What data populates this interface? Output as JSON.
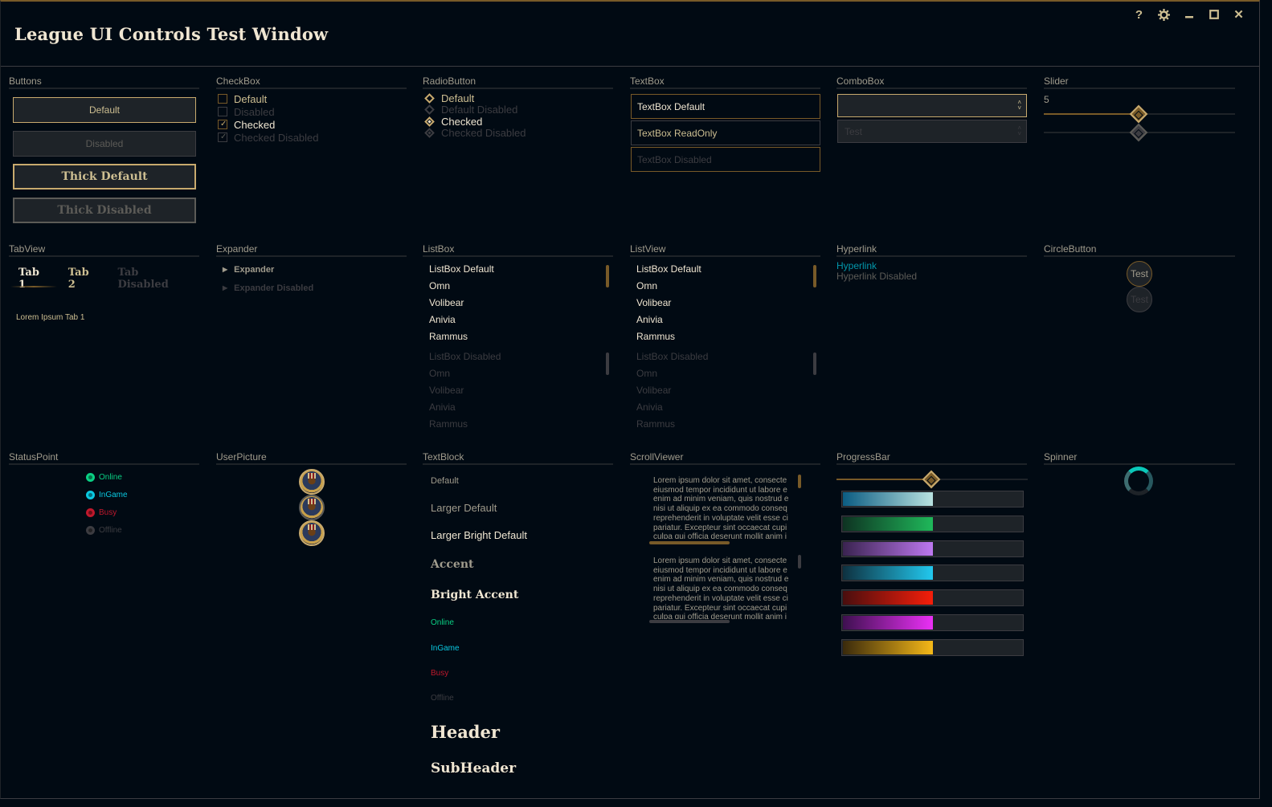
{
  "window": {
    "title": "League UI Controls Test Window",
    "buttons": [
      {
        "name": "help-button",
        "icon": "question-icon",
        "glyph": "?"
      },
      {
        "name": "settings-button",
        "icon": "gear-icon"
      },
      {
        "name": "minimize-button",
        "icon": "minimize-icon"
      },
      {
        "name": "maximize-button",
        "icon": "maximize-icon"
      },
      {
        "name": "close-button",
        "icon": "close-icon",
        "glyph": "✕"
      }
    ]
  },
  "colors": {
    "background": "#010a13",
    "gold": "#c8aa6e",
    "gold_dark": "#785a28",
    "text": "#a09b8c",
    "bright": "#f0e6d2",
    "online": "#0acf83",
    "ingame": "#0ac8e0",
    "busy": "#c0182c",
    "offline": "#3c3c41"
  },
  "sections": {
    "buttons": {
      "header": "Buttons",
      "items": [
        "Default",
        "Disabled",
        "Thick Default",
        "Thick Disabled"
      ]
    },
    "checkbox": {
      "header": "CheckBox",
      "items": [
        {
          "label": "Default",
          "checked": false,
          "enabled": true
        },
        {
          "label": "Disabled",
          "checked": false,
          "enabled": false
        },
        {
          "label": "Checked",
          "checked": true,
          "enabled": true
        },
        {
          "label": "Checked Disabled",
          "checked": true,
          "enabled": false
        }
      ]
    },
    "radio": {
      "header": "RadioButton",
      "items": [
        {
          "label": "Default",
          "checked": false,
          "enabled": true
        },
        {
          "label": "Default Disabled",
          "checked": false,
          "enabled": false
        },
        {
          "label": "Checked",
          "checked": true,
          "enabled": true
        },
        {
          "label": "Checked Disabled",
          "checked": true,
          "enabled": false
        }
      ]
    },
    "textbox": {
      "header": "TextBox",
      "items": [
        "TextBox Default",
        "TextBox ReadOnly",
        "TextBox Disabled"
      ]
    },
    "combobox": {
      "header": "ComboBox",
      "default_value": "",
      "disabled_value": "Test"
    },
    "slider": {
      "header": "Slider",
      "value_label": "5",
      "value": 5,
      "min": 0,
      "max": 10,
      "disabled_value": 5
    },
    "tabview": {
      "header": "TabView",
      "tabs": [
        "Tab 1",
        "Tab 2",
        "Tab Disabled"
      ],
      "content": "Lorem Ipsum Tab 1"
    },
    "expander": {
      "header": "Expander",
      "items": [
        "Expander",
        "Expander Disabled"
      ]
    },
    "listbox": {
      "header": "ListBox",
      "default_items": [
        "ListBox Default",
        "Omn",
        "Volibear",
        "Anivia",
        "Rammus"
      ],
      "disabled_items": [
        "ListBox Disabled",
        "Omn",
        "Volibear",
        "Anivia",
        "Rammus"
      ]
    },
    "listview": {
      "header": "ListView",
      "default_items": [
        "ListBox Default",
        "Omn",
        "Volibear",
        "Anivia",
        "Rammus"
      ],
      "disabled_items": [
        "ListBox Disabled",
        "Omn",
        "Volibear",
        "Anivia",
        "Rammus"
      ]
    },
    "hyperlink": {
      "header": "Hyperlink",
      "items": [
        "Hyperlink",
        "Hyperlink Disabled"
      ]
    },
    "circlebutton": {
      "header": "CircleButton",
      "items": [
        "Test",
        "Test"
      ]
    },
    "statuspoint": {
      "header": "StatusPoint",
      "items": [
        {
          "label": "Online",
          "color": "#0acf83",
          "text_color": "#0acf83"
        },
        {
          "label": "InGame",
          "color": "#0ac8e0",
          "text_color": "#0ac8e0"
        },
        {
          "label": "Busy",
          "color": "#c0182c",
          "text_color": "#c0182c"
        },
        {
          "label": "Offline",
          "color": "#3c3c41",
          "text_color": "#3c3c41"
        }
      ]
    },
    "userpicture": {
      "header": "UserPicture",
      "count": 3
    },
    "textblock": {
      "header": "TextBlock",
      "items": [
        "Default",
        "Larger Default",
        "Larger Bright Default",
        "Accent",
        "Bright Accent",
        "Online",
        "InGame",
        "Busy",
        "Offline",
        "Header",
        "SubHeader"
      ]
    },
    "scrollviewer": {
      "header": "ScrollViewer",
      "text_lines": [
        "Lorem ipsum dolor sit amet, consecte",
        "eiusmod tempor incididunt ut labore e",
        "enim ad minim veniam, quis nostrud e",
        "nisi ut aliquip ex ea commodo conseq",
        "reprehenderit in voluptate velit esse ci",
        "pariatur. Excepteur sint occaecat cupi",
        "culpa qui officia deserunt mollit anim i"
      ]
    },
    "progressbar": {
      "header": "ProgressBar",
      "slider_value": 50,
      "bars": [
        {
          "value": 50,
          "from": "#0b5c82",
          "to": "#b9e2e0"
        },
        {
          "value": 50,
          "from": "#0e3322",
          "to": "#1fb85a"
        },
        {
          "value": 50,
          "from": "#3a2350",
          "to": "#bd78f0"
        },
        {
          "value": 50,
          "from": "#0e3140",
          "to": "#22c8ee"
        },
        {
          "value": 50,
          "from": "#4a0e0e",
          "to": "#f51e0a"
        },
        {
          "value": 50,
          "from": "#3e1050",
          "to": "#ea30f5"
        },
        {
          "value": 50,
          "from": "#3a2a0c",
          "to": "#f5b818"
        }
      ]
    },
    "spinner": {
      "header": "Spinner"
    }
  }
}
